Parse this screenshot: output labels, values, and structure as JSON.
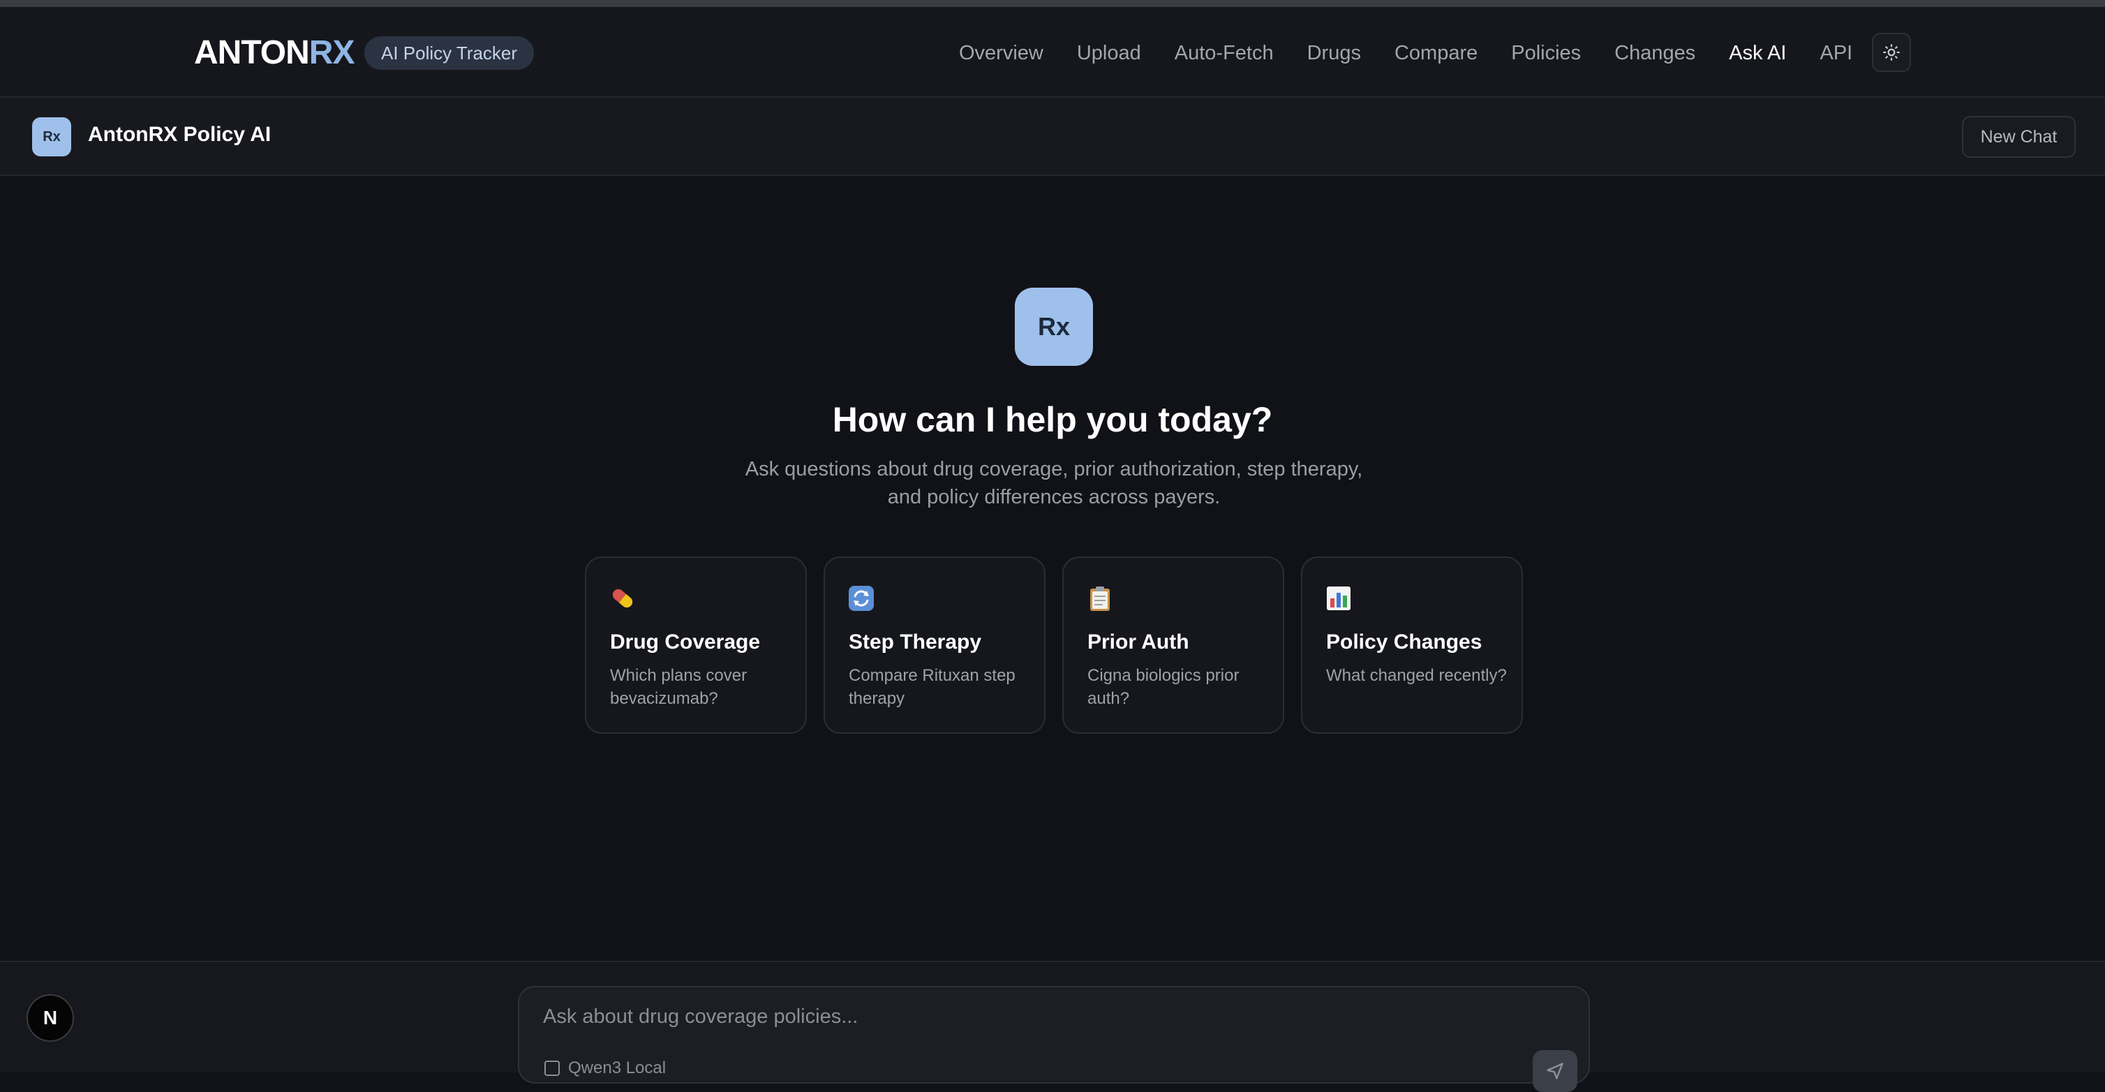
{
  "header": {
    "logo_primary": "ANTON",
    "logo_accent": "RX",
    "tag": "AI Policy Tracker",
    "nav": [
      "Overview",
      "Upload",
      "Auto-Fetch",
      "Drugs",
      "Compare",
      "Policies",
      "Changes",
      "Ask AI",
      "API"
    ],
    "active_nav": "Ask AI",
    "theme_icon": "sun-icon"
  },
  "chat_header": {
    "avatar_text": "Rx",
    "title": "AntonRX Policy AI",
    "new_chat_label": "New Chat"
  },
  "hero": {
    "avatar_text": "Rx",
    "title": "How can I help you today?",
    "subtitle_line1": "Ask questions about drug coverage, prior authorization, step therapy,",
    "subtitle_line2": "and policy differences across payers."
  },
  "cards": [
    {
      "icon": "pill-icon",
      "title": "Drug Coverage",
      "desc": "Which plans cover bevacizumab?"
    },
    {
      "icon": "refresh-icon",
      "title": "Step Therapy",
      "desc": "Compare Rituxan step therapy"
    },
    {
      "icon": "clipboard-icon",
      "title": "Prior Auth",
      "desc": "Cigna biologics prior auth?"
    },
    {
      "icon": "bar-chart-icon",
      "title": "Policy Changes",
      "desc": "What changed recently?"
    }
  ],
  "composer": {
    "placeholder": "Ask about drug coverage policies...",
    "model_label": "Qwen3 Local"
  },
  "badge_letter": "N",
  "colors": {
    "background": "#111217",
    "accent": "#9fc0ea",
    "logo_accent": "#8fb4e6"
  }
}
